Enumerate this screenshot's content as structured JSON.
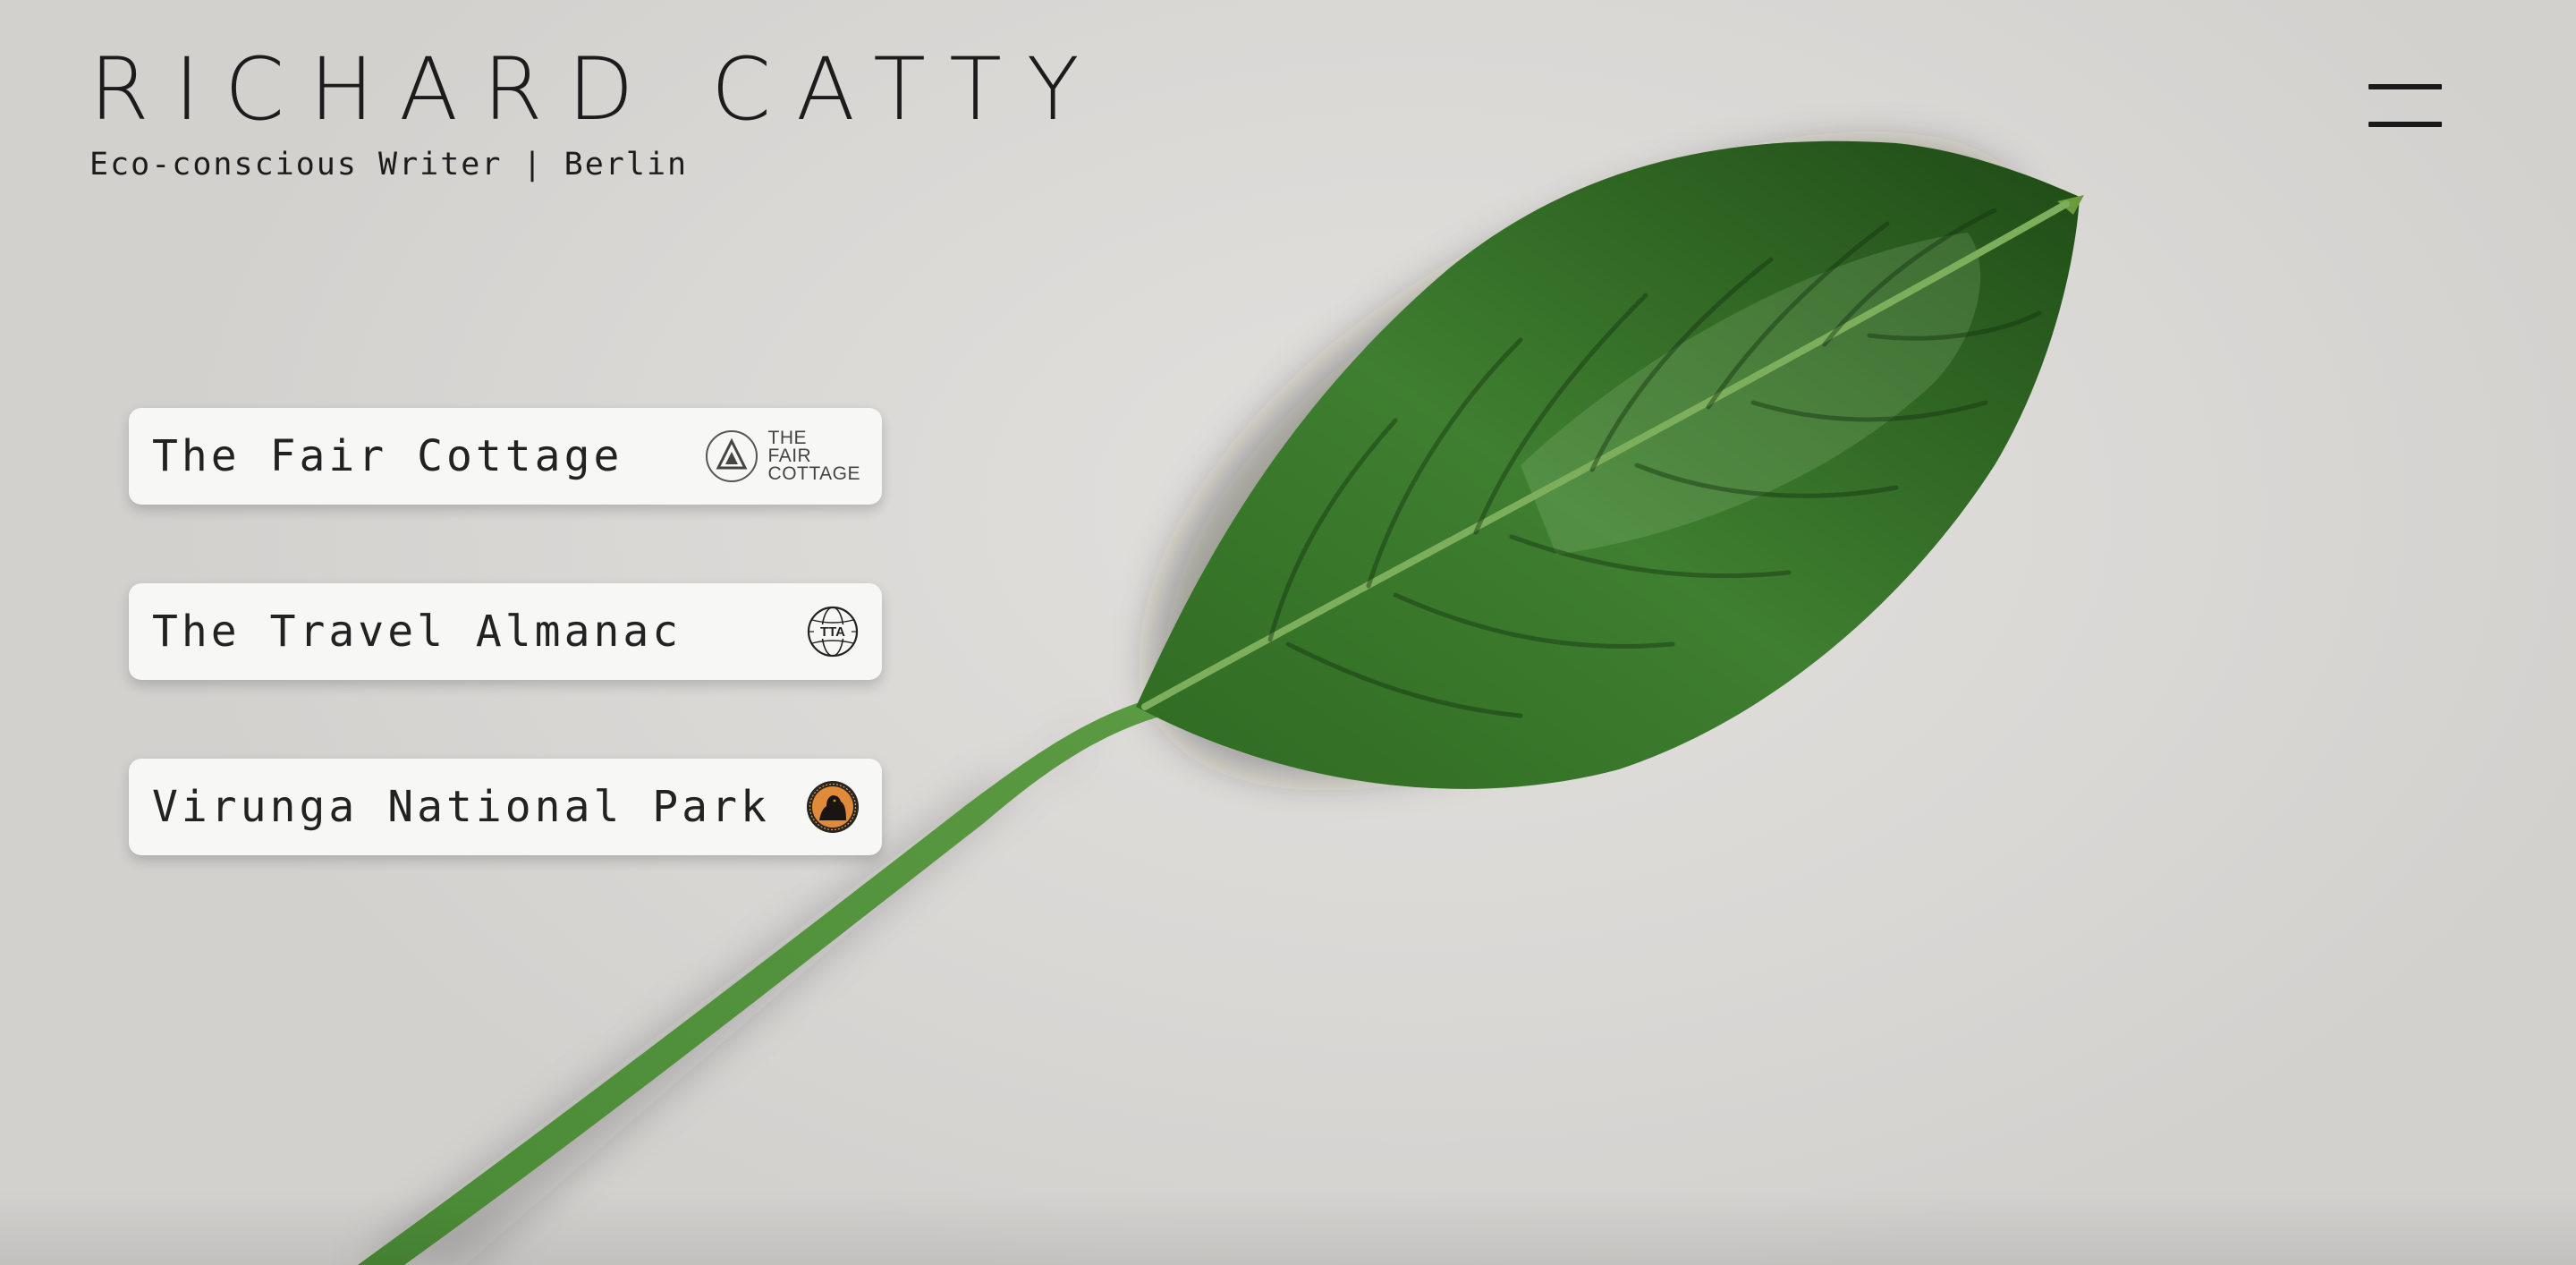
{
  "header": {
    "site_name": "RICHARD CATTY",
    "tagline": "Eco-conscious Writer | Berlin",
    "menu_icon": "hamburger-menu-icon"
  },
  "links": [
    {
      "label": "The Fair Cottage",
      "logo": "fair-cottage-logo",
      "logo_text": [
        "THE",
        "FAIR",
        "COTTAGE"
      ]
    },
    {
      "label": "The Travel Almanac",
      "logo": "travel-almanac-globe-logo",
      "logo_text": [
        "TTA"
      ]
    },
    {
      "label": "Virunga National Park",
      "logo": "virunga-gorilla-seal-logo",
      "logo_text": []
    }
  ],
  "colors": {
    "background": "#dcdad7",
    "card": "#f7f7f6",
    "text": "#1c1c1c",
    "leaf": "#3e7a2e",
    "virunga_accent": "#e08a3a"
  }
}
